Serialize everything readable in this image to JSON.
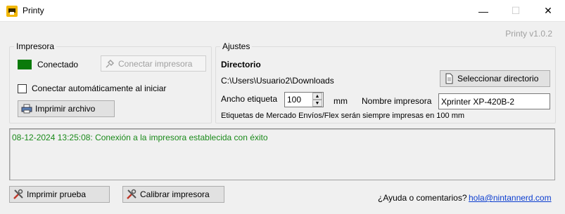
{
  "window": {
    "title": "Printy",
    "minimize_glyph": "—",
    "maximize_glyph": "☐",
    "close_glyph": "✕",
    "version": "Printy v1.0.2"
  },
  "printer_group": {
    "title": "Impresora",
    "status_label": "Conectado",
    "status_color": "#0a7a0a",
    "connect_button": "Conectar impresora",
    "auto_connect_label": "Conectar automáticamente al iniciar",
    "auto_connect_checked": false,
    "print_file_button": "Imprimir archivo"
  },
  "settings_group": {
    "title": "Ajustes",
    "directory_heading": "Directorio",
    "directory_path": "C:\\Users\\Usuario2\\Downloads",
    "select_directory_button": "Seleccionar directorio",
    "label_width_label": "Ancho etiqueta",
    "label_width_value": "100",
    "label_width_unit": "mm",
    "printer_name_label": "Nombre impresora",
    "printer_name_value": "Xprinter XP-420B-2",
    "note": "Etiquetas de Mercado Envíos/Flex serán siempre impresas en 100 mm"
  },
  "log": {
    "lines": [
      "08-12-2024 13:25:08: Conexión a la impresora establecida con éxito"
    ],
    "text_color": "#1a8a1a"
  },
  "footer": {
    "print_test_button": "Imprimir prueba",
    "calibrate_button": "Calibrar impresora",
    "help_text": "¿Ayuda o comentarios?",
    "email": "hola@nintannerd.com"
  },
  "icons": {
    "app": "printy-app-icon",
    "connect": "plug-icon",
    "print": "printer-icon",
    "folder": "document-icon",
    "tools": "tools-icon"
  }
}
